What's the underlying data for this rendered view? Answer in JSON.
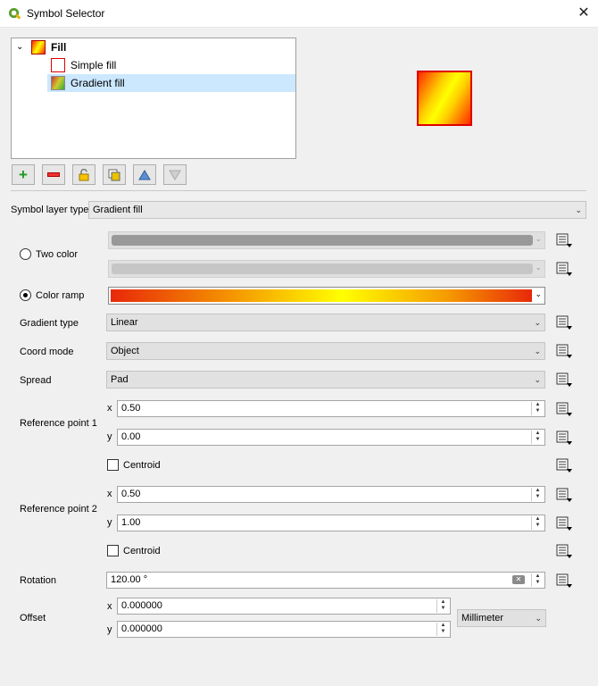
{
  "window": {
    "title": "Symbol Selector",
    "close_label": "✕"
  },
  "tree": {
    "root_label": "Fill",
    "items": [
      {
        "label": "Simple fill"
      },
      {
        "label": "Gradient fill"
      }
    ]
  },
  "symbol_layer_type": {
    "label": "Symbol layer type",
    "value": "Gradient fill"
  },
  "colors": {
    "two_color_label": "Two color",
    "color_ramp_label": "Color ramp",
    "selected_mode": "Color ramp"
  },
  "gradient_type": {
    "label": "Gradient type",
    "value": "Linear"
  },
  "coord_mode": {
    "label": "Coord mode",
    "value": "Object"
  },
  "spread": {
    "label": "Spread",
    "value": "Pad"
  },
  "ref1": {
    "label": "Reference point 1",
    "x_label": "x",
    "x": "0.50",
    "y_label": "y",
    "y": "0.00",
    "centroid_label": "Centroid"
  },
  "ref2": {
    "label": "Reference point 2",
    "x_label": "x",
    "x": "0.50",
    "y_label": "y",
    "y": "1.00",
    "centroid_label": "Centroid"
  },
  "rotation": {
    "label": "Rotation",
    "value": "120.00 °"
  },
  "offset": {
    "label": "Offset",
    "x_label": "x",
    "x": "0.000000",
    "y_label": "y",
    "y": "0.000000",
    "unit": "Millimeter"
  },
  "accent": "#0078d7"
}
